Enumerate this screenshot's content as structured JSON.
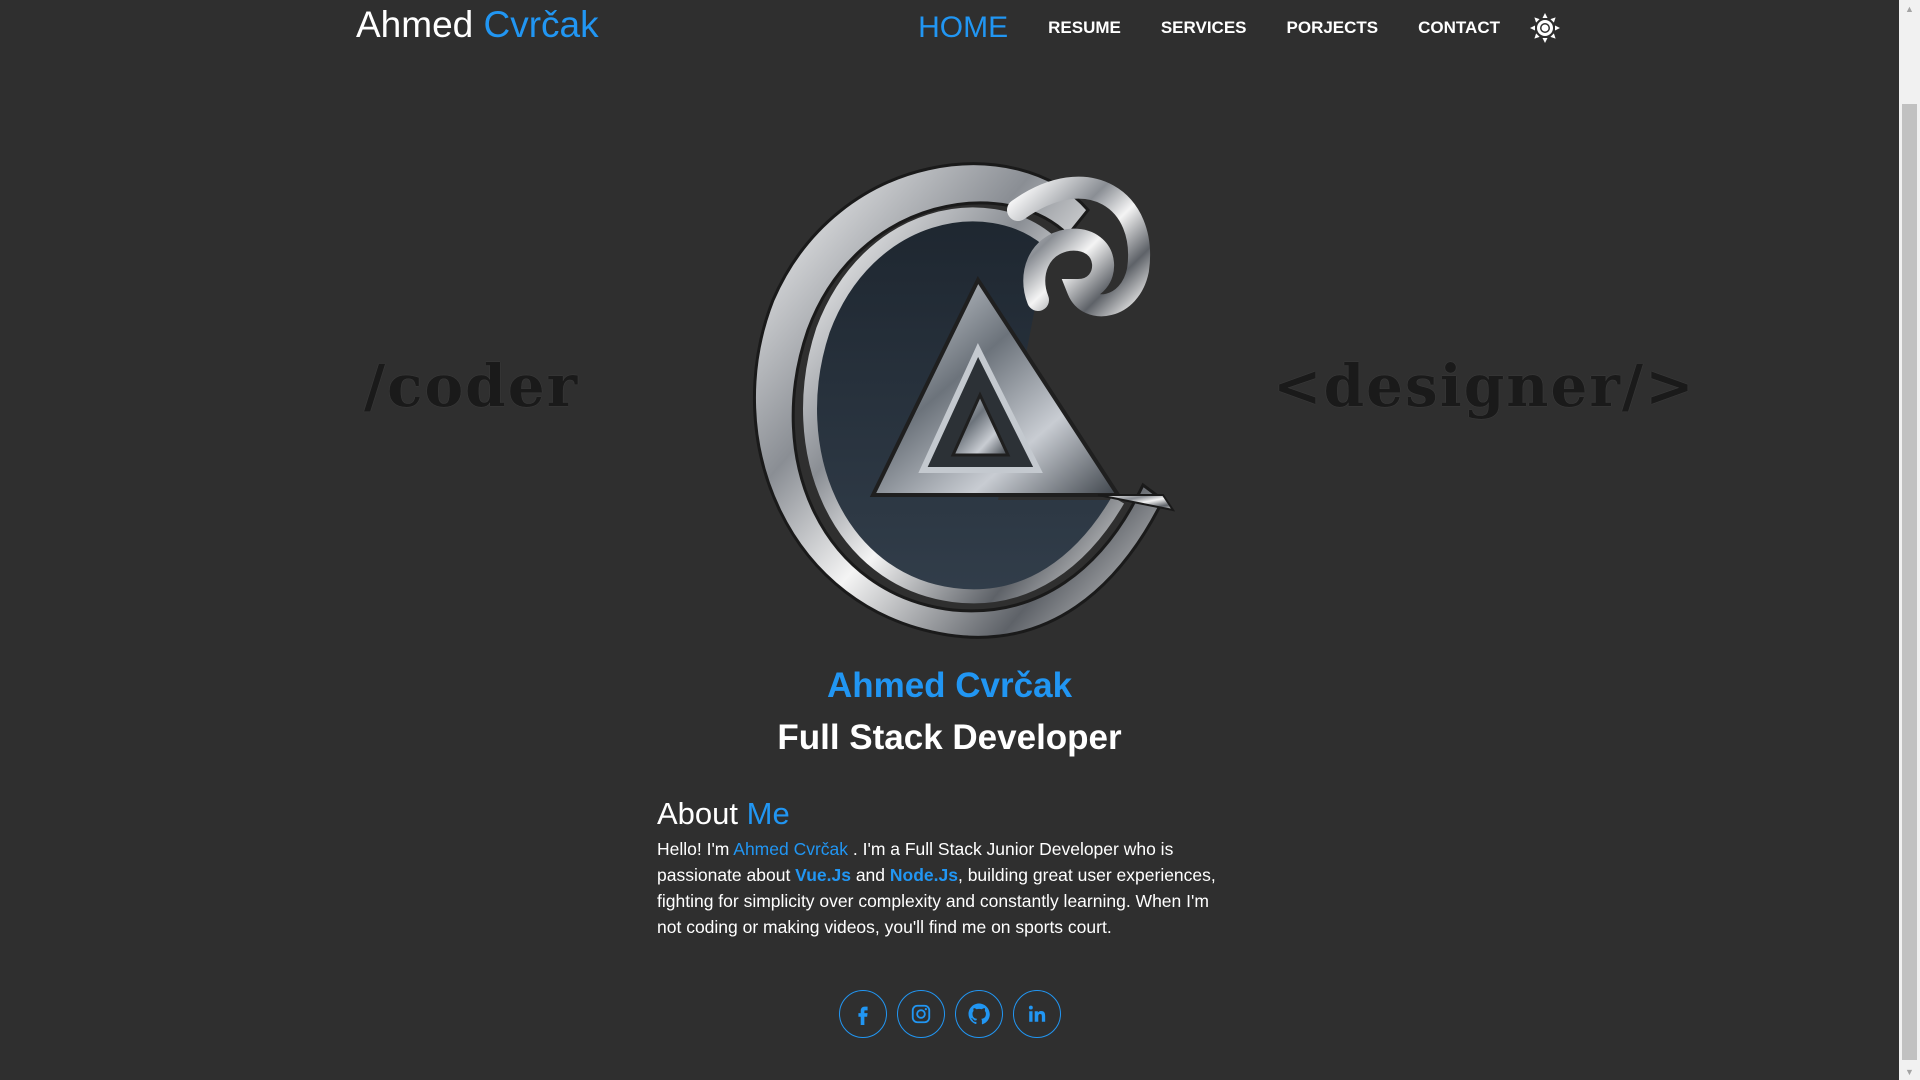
{
  "nav": {
    "brand_first": "Ahmed",
    "brand_last": "Cvrčak",
    "links": [
      {
        "label": "HOME",
        "active": true
      },
      {
        "label": "RESUME",
        "active": false
      },
      {
        "label": "SERVICES",
        "active": false
      },
      {
        "label": "PORJECTS",
        "active": false
      },
      {
        "label": "CONTACT",
        "active": false
      }
    ],
    "theme_icon": "sun-icon"
  },
  "hero": {
    "left_word": "/coder",
    "right_word": "<designer/>",
    "name": "Ahmed Cvrčak",
    "role": "Full Stack Developer"
  },
  "about": {
    "title_first": "About",
    "title_accent": "Me",
    "text_1": "Hello! I'm ",
    "name_link": "Ahmed Cvrčak",
    "text_2": " . I'm a Full Stack Junior Developer who is passionate about ",
    "tech_1": "Vue.Js",
    "text_3": " and ",
    "tech_2": "Node.Js",
    "text_4": ", building great user experiences, fighting for simplicity over complexity and constantly learning. When I'm not coding or making videos, you'll find me on sports court."
  },
  "social": [
    {
      "icon": "facebook-icon"
    },
    {
      "icon": "instagram-icon"
    },
    {
      "icon": "github-icon"
    },
    {
      "icon": "linkedin-icon"
    }
  ],
  "colors": {
    "accent": "#2196f3",
    "background": "#2f2f2f",
    "text": "#ffffff"
  }
}
